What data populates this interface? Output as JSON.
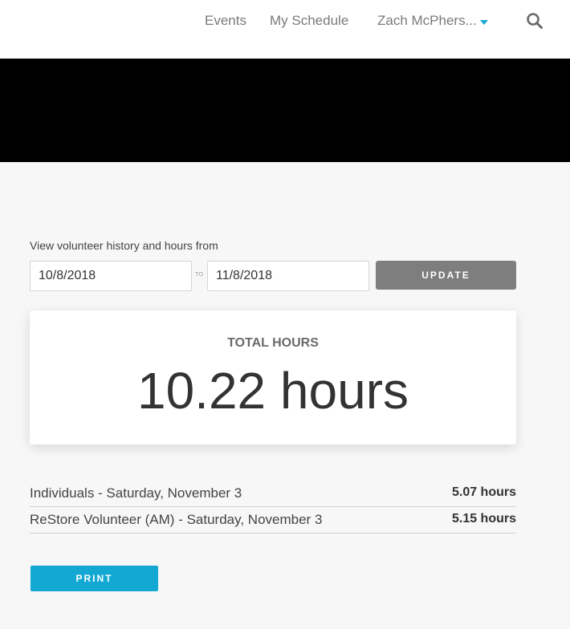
{
  "nav": {
    "events": "Events",
    "my_schedule": "My Schedule",
    "user": "Zach McPhers...",
    "search_icon": "search-icon",
    "caret_icon": "chevron-down-icon",
    "accent_color": "#1ea7d4"
  },
  "history": {
    "label": "View volunteer history and hours from",
    "from_value": "10/8/2018",
    "to_label": "TO",
    "to_value": "11/8/2018",
    "update_label": "UPDATE"
  },
  "total": {
    "title": "TOTAL HOURS",
    "value": "10.22 hours"
  },
  "entries": [
    {
      "name": "Individuals - Saturday, November 3",
      "hours": "5.07 hours"
    },
    {
      "name": "ReStore Volunteer (AM) - Saturday, November 3",
      "hours": "5.15 hours"
    }
  ],
  "actions": {
    "print_label": "PRINT",
    "print_color": "#12a8d3"
  }
}
